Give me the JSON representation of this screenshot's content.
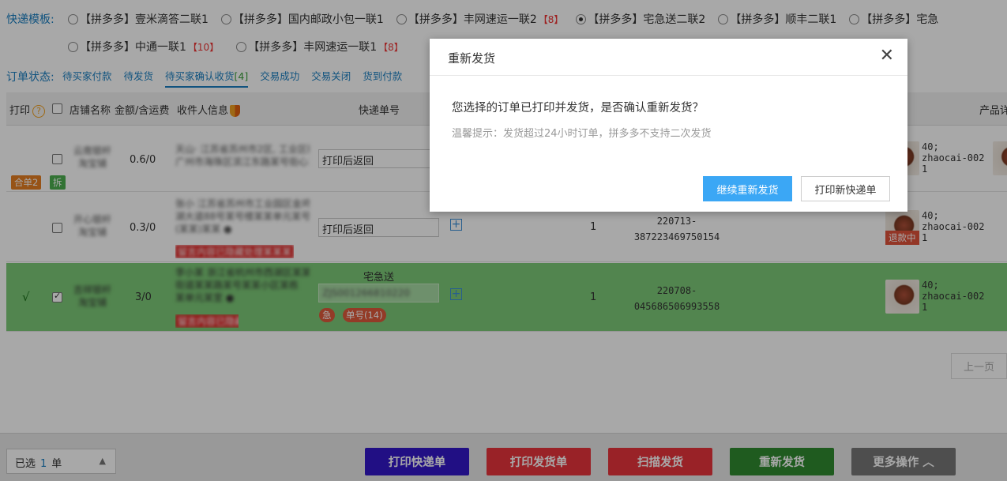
{
  "templates": {
    "label": "快递模板:",
    "row1": [
      {
        "name": "【拼多多】壹米滴答二联1",
        "count": "",
        "checked": false
      },
      {
        "name": "【拼多多】国内邮政小包一联1",
        "count": "",
        "checked": false
      },
      {
        "name": "【拼多多】丰网速运一联2",
        "count": "【8】",
        "checked": false
      },
      {
        "name": "【拼多多】宅急送二联2",
        "count": "",
        "checked": true
      },
      {
        "name": "【拼多多】顺丰二联1",
        "count": "",
        "checked": false
      },
      {
        "name": "【拼多多】宅急",
        "count": "",
        "checked": false
      }
    ],
    "row2": [
      {
        "name": "【拼多多】中通一联1",
        "count": "【10】",
        "checked": false
      },
      {
        "name": "【拼多多】丰网速运一联1",
        "count": "【8】",
        "checked": false
      }
    ]
  },
  "status": {
    "label": "订单状态:",
    "tabs": [
      {
        "label": "待买家付款",
        "badge": ""
      },
      {
        "label": "待发货",
        "badge": ""
      },
      {
        "label": "待买家确认收货",
        "badge": "[4]"
      },
      {
        "label": "交易成功",
        "badge": ""
      },
      {
        "label": "交易关闭",
        "badge": ""
      },
      {
        "label": "货到付款",
        "badge": ""
      }
    ]
  },
  "table": {
    "headers": {
      "print": "打印",
      "print_help": "?",
      "shop": "店铺名称",
      "amount": "金额/含运费",
      "receiver": "收件人信息",
      "waybill": "快递单号",
      "product": "产品详"
    },
    "rows": [
      {
        "printed_mark": "",
        "shop": "云南银杆 淘宝铺",
        "amount": "0.6/0",
        "receiver_lines": [
          "天山· 江苏省苏州市2区, 工业区街道",
          "广州市海珠区滨江东路某号街心1号 ●"
        ],
        "waybill": "打印后返回",
        "tags": [
          {
            "text": "合单2",
            "color": "#e67e22"
          },
          {
            "text": "拆",
            "color": "#4caf50"
          }
        ],
        "qty": "",
        "order_no": "",
        "product_spec": [
          "40;",
          "zhaocai-002",
          "1"
        ],
        "refund": ""
      },
      {
        "printed_mark": "",
        "shop": "开心银杆 淘宝铺",
        "amount": "0.3/0",
        "receiver_lines": [
          "张小 江苏省苏州市工业园区金鸡",
          "湖大道88号某号楼某某单元某号",
          "(某某)某某 ●"
        ],
        "waybill": "打印后返回",
        "red_note": "留言内容已隐藏处理某某某",
        "tags": [],
        "qty": "1",
        "order_no": [
          "220713-",
          "387223469750154"
        ],
        "product_spec": [
          "40;",
          "zhaocai-002",
          "1"
        ],
        "refund": "退款中"
      },
      {
        "printed_mark": "√",
        "shop": "吉祥银杆 淘宝铺",
        "amount": "3/0",
        "receiver_lines": [
          "李小某 浙江省杭州市西湖区某某",
          "街道某某路某号某某小区某栋",
          "某单元某室 ●"
        ],
        "express_name": "宅急送",
        "waybill": "ZJS001266810220",
        "red_note": "留言内容已隐藏",
        "tags": [
          {
            "text": "单号(14)",
            "color": "#e05a3c"
          }
        ],
        "qty": "1",
        "order_no": [
          "220708-",
          "045686506993558"
        ],
        "product_spec": [
          "40;",
          "zhaocai-002",
          "1"
        ],
        "refund": ""
      }
    ]
  },
  "pager": {
    "prev": "上一页"
  },
  "modal": {
    "title": "重新发货",
    "message": "您选择的订单已打印并发货，是否确认重新发货？",
    "tip": "温馨提示：发货超过24小时订单，拼多多不支持二次发货",
    "confirm": "继续重新发货",
    "alt": "打印新快递单"
  },
  "bottom": {
    "selected_prefix": "已选",
    "selected_count": "1",
    "selected_suffix": "单",
    "buttons": [
      {
        "label": "打印快递单",
        "color": "#3317c9"
      },
      {
        "label": "打印发货单",
        "color": "#e8353c"
      },
      {
        "label": "扫描发货",
        "color": "#e8353c"
      },
      {
        "label": "重新发货",
        "color": "#2f8a2f"
      },
      {
        "label": "更多操作 ︿",
        "color": "#777777"
      }
    ]
  }
}
